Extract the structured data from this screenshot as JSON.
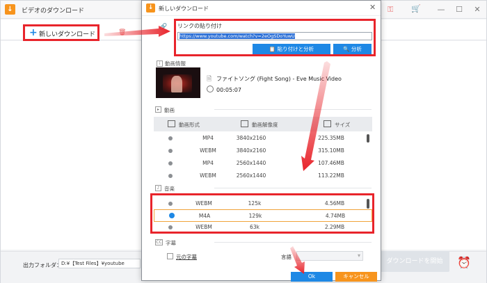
{
  "app": {
    "title": "ビデオのダウンロード",
    "new_download_label": "新しいダウンロード",
    "output_folder_label": "出力フォルダ：",
    "output_folder_path": "D:¥【Test Files】¥youtube",
    "start_download_label": "ダウンロードを開始",
    "minimize_icon": "minimize-icon",
    "maximize_icon": "maximize-icon",
    "close_icon": "close-icon"
  },
  "dialog": {
    "title": "新しいダウンロード",
    "paste_link_label": "リンクの貼り付け",
    "url_value": "https://www.youtube.com/watch?v=2eOgSDoYuwU",
    "paste_and_analyze_label": "貼り付けと分析",
    "analyze_label": "分析",
    "video_info_header": "動画情報",
    "video_title": "ファイトソング (Fight Song) - Eve Music Video",
    "video_duration": "00:05:07",
    "video_section_header": "動画",
    "video_columns": [
      "動画形式",
      "動画解像度",
      "サイズ"
    ],
    "video_rows": [
      {
        "format": "MP4",
        "resolution": "3840x2160",
        "size": "225.35MB"
      },
      {
        "format": "WEBM",
        "resolution": "3840x2160",
        "size": "315.10MB"
      },
      {
        "format": "MP4",
        "resolution": "2560x1440",
        "size": "107.46MB"
      },
      {
        "format": "WEBM",
        "resolution": "2560x1440",
        "size": "113.22MB"
      }
    ],
    "audio_section_header": "音楽",
    "audio_rows": [
      {
        "format": "WEBM",
        "bitrate": "125k",
        "size": "4.56MB",
        "selected": false
      },
      {
        "format": "M4A",
        "bitrate": "129k",
        "size": "4.74MB",
        "selected": true
      },
      {
        "format": "WEBM",
        "bitrate": "63k",
        "size": "2.29MB",
        "selected": false
      }
    ],
    "subtitle_section_header": "字幕",
    "original_subtitle_label": "元の字幕",
    "language_label": "言語",
    "ok_label": "Ok",
    "cancel_label": "キャンセル"
  },
  "colors": {
    "accent_blue": "#1e88e5",
    "brand_orange": "#f7941d",
    "highlight_red": "#e8242b"
  }
}
